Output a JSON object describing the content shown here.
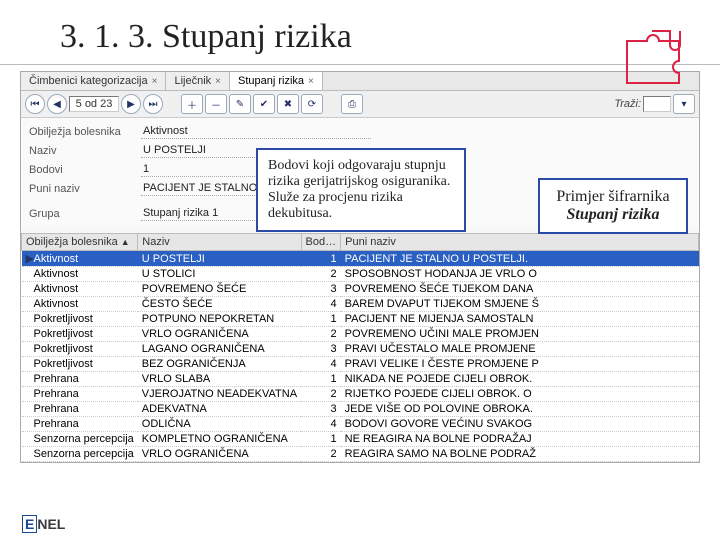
{
  "slide": {
    "title": "3. 1. 3. Stupanj rizika"
  },
  "tabs": [
    {
      "label": "Čimbenici kategorizacija",
      "active": false
    },
    {
      "label": "Liječnik",
      "active": false
    },
    {
      "label": "Stupanj rizika",
      "active": true
    }
  ],
  "toolbar": {
    "pager": "5 od 23",
    "search_label": "Traži:"
  },
  "form": {
    "obiljezja_label": "Obilježja bolesnika",
    "obiljezja_value": "Aktivnost",
    "naziv_label": "Naziv",
    "naziv_value": "U POSTELJI",
    "bodovi_label": "Bodovi",
    "bodovi_value": "1",
    "puni_label": "Puni naziv",
    "puni_value": "PACIJENT JE STALNO U",
    "grupa_label": "Grupa",
    "grupa_value": "Stupanj rizika 1"
  },
  "grid": {
    "headers": {
      "c1": "Obilježja bolesnika",
      "c2": "Naziv",
      "c3": "Bod…",
      "c4": "Puni naziv"
    },
    "rows": [
      {
        "c1": "Aktivnost",
        "c2": "U POSTELJI",
        "c3": "1",
        "c4": "PACIJENT JE STALNO U POSTELJI.",
        "sel": true
      },
      {
        "c1": "Aktivnost",
        "c2": "U STOLICI",
        "c3": "2",
        "c4": "SPOSOBNOST HODANJA JE VRLO O"
      },
      {
        "c1": "Aktivnost",
        "c2": "POVREMENO ŠEĆE",
        "c3": "3",
        "c4": "POVREMENO ŠEĆE TIJEKOM DANA"
      },
      {
        "c1": "Aktivnost",
        "c2": "ČESTO ŠEĆE",
        "c3": "4",
        "c4": "BAREM DVAPUT TIJEKOM SMJENE Š"
      },
      {
        "c1": "Pokretljivost",
        "c2": "POTPUNO NEPOKRETAN",
        "c3": "1",
        "c4": "PACIJENT NE MIJENJA SAMOSTALN"
      },
      {
        "c1": "Pokretljivost",
        "c2": "VRLO OGRANIČENA",
        "c3": "2",
        "c4": "POVREMENO UČINI MALE PROMJEN"
      },
      {
        "c1": "Pokretljivost",
        "c2": "LAGANO OGRANIČENA",
        "c3": "3",
        "c4": "PRAVI UČESTALO MALE PROMJENE"
      },
      {
        "c1": "Pokretljivost",
        "c2": "BEZ OGRANIČENJA",
        "c3": "4",
        "c4": "PRAVI VELIKE I ČESTE PROMJENE P"
      },
      {
        "c1": "Prehrana",
        "c2": "VRLO SLABA",
        "c3": "1",
        "c4": "NIKADA NE POJEDE CIJELI OBROK."
      },
      {
        "c1": "Prehrana",
        "c2": "VJEROJATNO NEADEKVATNA",
        "c3": "2",
        "c4": "RIJETKO POJEDE CIJELI OBROK. O"
      },
      {
        "c1": "Prehrana",
        "c2": "ADEKVATNA",
        "c3": "3",
        "c4": "JEDE VIŠE OD POLOVINE OBROKA."
      },
      {
        "c1": "Prehrana",
        "c2": "ODLIČNA",
        "c3": "4",
        "c4": "BODOVI GOVORE VEĆINU SVAKOG"
      },
      {
        "c1": "Senzorna percepcija",
        "c2": "KOMPLETNO OGRANIČENA",
        "c3": "1",
        "c4": "NE REAGIRA NA BOLNE PODRAŽAJ"
      },
      {
        "c1": "Senzorna percepcija",
        "c2": "VRLO OGRANIČENA",
        "c3": "2",
        "c4": "REAGIRA SAMO NA BOLNE PODRAŽ"
      }
    ]
  },
  "callouts": {
    "c1": "Bodovi koji odgovaraju stupnju rizika gerijatrijskog osiguranika.\nSluže za procjenu rizika dekubitusa.",
    "c2a": "Primjer šifrarnika",
    "c2b": "Stupanj rizika"
  },
  "logo": {
    "boxed": "E",
    "rest": "NEL"
  }
}
